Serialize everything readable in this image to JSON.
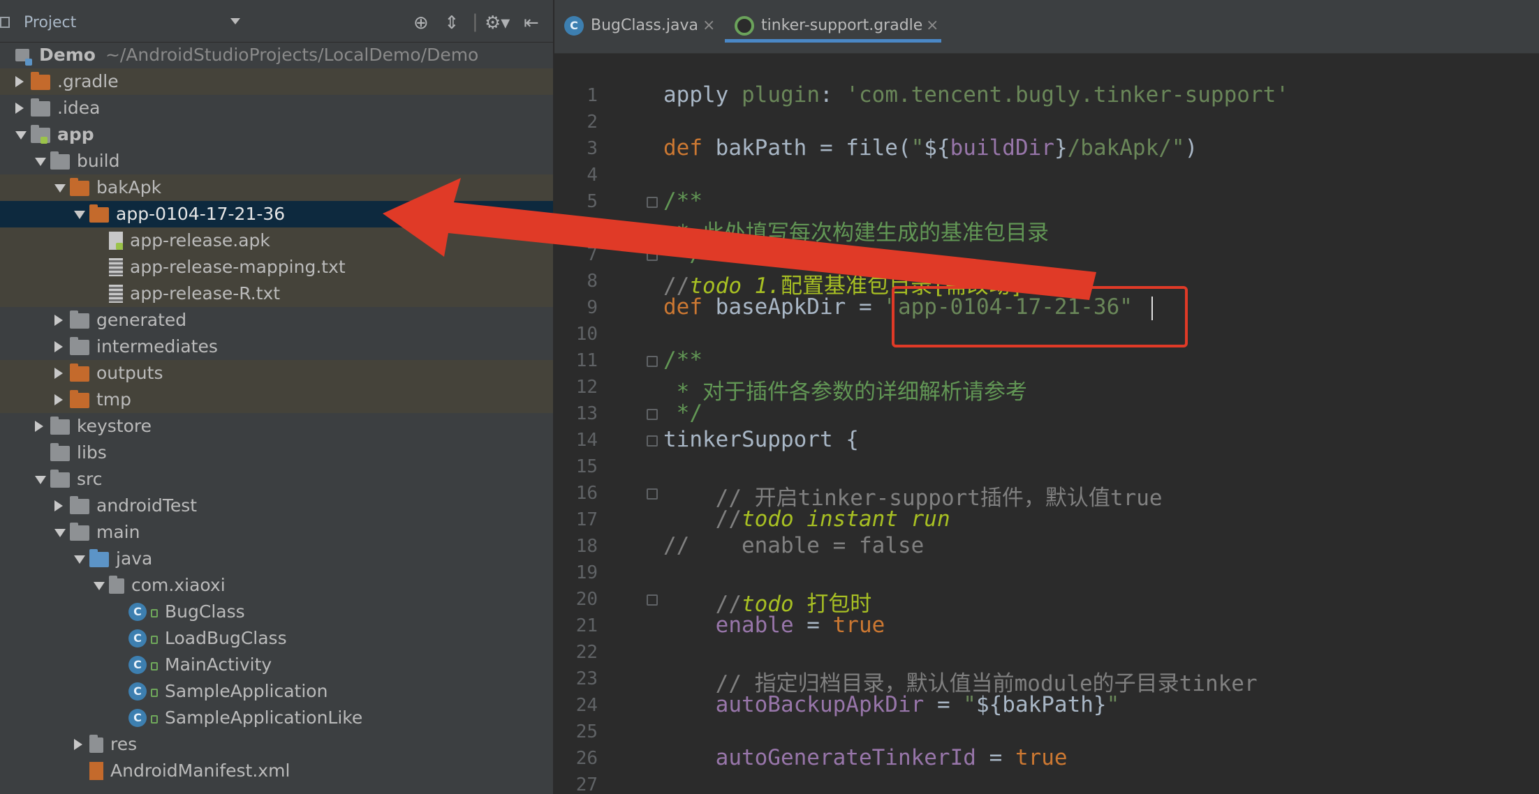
{
  "panel": {
    "title": "Project",
    "root_name": "Demo",
    "root_path": "~/AndroidStudioProjects/LocalDemo/Demo"
  },
  "tree": [
    {
      "label": ".gradle",
      "depth": 1,
      "arrow": "right",
      "icon": "folder-orange-icon",
      "highlight": true
    },
    {
      "label": ".idea",
      "depth": 1,
      "arrow": "right",
      "icon": "folder-icon"
    },
    {
      "label": "app",
      "depth": 1,
      "arrow": "down",
      "icon": "module-folder-icon",
      "bold": true
    },
    {
      "label": "build",
      "depth": 2,
      "arrow": "down",
      "icon": "folder-icon"
    },
    {
      "label": "bakApk",
      "depth": 3,
      "arrow": "down",
      "icon": "folder-orange-icon",
      "highlight": true
    },
    {
      "label": "app-0104-17-21-36",
      "depth": 4,
      "arrow": "down",
      "icon": "folder-orange-icon",
      "selected": true
    },
    {
      "label": "app-release.apk",
      "depth": 5,
      "icon": "apk-file-icon",
      "highlight": true
    },
    {
      "label": "app-release-mapping.txt",
      "depth": 5,
      "icon": "text-file-icon",
      "highlight": true
    },
    {
      "label": "app-release-R.txt",
      "depth": 5,
      "icon": "text-file-icon",
      "highlight": true
    },
    {
      "label": "generated",
      "depth": 3,
      "arrow": "right",
      "icon": "folder-icon"
    },
    {
      "label": "intermediates",
      "depth": 3,
      "arrow": "right",
      "icon": "folder-icon"
    },
    {
      "label": "outputs",
      "depth": 3,
      "arrow": "right",
      "icon": "folder-orange-icon",
      "highlight": true
    },
    {
      "label": "tmp",
      "depth": 3,
      "arrow": "right",
      "icon": "folder-orange-icon",
      "highlight": true
    },
    {
      "label": "keystore",
      "depth": 2,
      "arrow": "right",
      "icon": "folder-icon"
    },
    {
      "label": "libs",
      "depth": 2,
      "icon": "folder-icon"
    },
    {
      "label": "src",
      "depth": 2,
      "arrow": "down",
      "icon": "folder-icon"
    },
    {
      "label": "androidTest",
      "depth": 3,
      "arrow": "right",
      "icon": "folder-icon"
    },
    {
      "label": "main",
      "depth": 3,
      "arrow": "down",
      "icon": "folder-icon"
    },
    {
      "label": "java",
      "depth": 4,
      "arrow": "down",
      "icon": "folder-blue-icon"
    },
    {
      "label": "com.xiaoxi",
      "depth": 5,
      "arrow": "down",
      "icon": "package-icon"
    },
    {
      "label": "BugClass",
      "depth": 6,
      "icon": "class-icon"
    },
    {
      "label": "LoadBugClass",
      "depth": 6,
      "icon": "class-icon"
    },
    {
      "label": "MainActivity",
      "depth": 6,
      "icon": "class-icon"
    },
    {
      "label": "SampleApplication",
      "depth": 6,
      "icon": "class-icon"
    },
    {
      "label": "SampleApplicationLike",
      "depth": 6,
      "icon": "class-icon"
    },
    {
      "label": "res",
      "depth": 4,
      "arrow": "right",
      "icon": "res-folder-icon"
    },
    {
      "label": "AndroidManifest.xml",
      "depth": 4,
      "icon": "manifest-icon"
    }
  ],
  "tabs": [
    {
      "label": "BugClass.java",
      "icon": "java-class-icon",
      "close": "×"
    },
    {
      "label": "tinker-support.gradle",
      "icon": "gradle-icon",
      "close": "×",
      "active": true
    }
  ],
  "code_lines": [
    {
      "n": "1",
      "html": "<span class='fn'>apply</span> <span class='str' style='color:#6a8759'>plugin</span><span class='fn'>:</span> <span class='str'>'com.tencent.bugly.tinker-support'</span>"
    },
    {
      "n": "2",
      "html": ""
    },
    {
      "n": "3",
      "html": "<span class='kw'>def</span> bakPath = file(<span class='str'>\"</span>${<span class='prop'>buildDir</span>}<span class='str'>/bakApk/\"</span>)"
    },
    {
      "n": "4",
      "html": ""
    },
    {
      "n": "5",
      "html": "<span class='doc'>/**</span>",
      "fold": true
    },
    {
      "n": "6",
      "html": "<span class='doc'> * 此处填写每次构建生成的基准包目录</span>"
    },
    {
      "n": "7",
      "html": "<span class='doc'> */</span>",
      "fold": true
    },
    {
      "n": "8",
      "html": "<span class='cm'>//</span><span class='todo'>todo 1.</span><span class='todo-n'>配置基准包目录[需改动]</span>"
    },
    {
      "n": "9",
      "html": "<span class='kw'>def</span> baseApkDir = <span class='str'>\"app-0104-17-21-36\"</span>"
    },
    {
      "n": "10",
      "html": ""
    },
    {
      "n": "11",
      "html": "<span class='doc'>/**</span>",
      "fold": true
    },
    {
      "n": "12",
      "html": "<span class='doc'> * 对于插件各参数的详细解析请参考</span>"
    },
    {
      "n": "13",
      "html": "<span class='doc'> */</span>",
      "fold": true
    },
    {
      "n": "14",
      "html": "tinkerSupport {",
      "fold": true
    },
    {
      "n": "15",
      "html": ""
    },
    {
      "n": "16",
      "html": "    <span class='cm'>// 开启tinker-support插件，默认值true</span>",
      "fold": true
    },
    {
      "n": "17",
      "html": "    <span class='cm'>//</span><span class='todo'>todo instant run</span>"
    },
    {
      "n": "18",
      "html": "<span class='cm'>//    enable = false</span>"
    },
    {
      "n": "19",
      "html": ""
    },
    {
      "n": "20",
      "html": "    <span class='cm'>//</span><span class='todo'>todo </span><span class='todo-n'>打包时</span>",
      "fold": true
    },
    {
      "n": "21",
      "html": "    <span class='prop'>enable</span> = <span class='kw'>true</span>"
    },
    {
      "n": "22",
      "html": ""
    },
    {
      "n": "23",
      "html": "    <span class='cm'>// 指定归档目录，默认值当前module的子目录tinker</span>"
    },
    {
      "n": "24",
      "html": "    <span class='prop'>autoBackupApkDir</span> = <span class='str'>\"</span>${bakPath}<span class='str'>\"</span>"
    },
    {
      "n": "25",
      "html": ""
    },
    {
      "n": "26",
      "html": "    <span class='prop'>autoGenerateTinkerId</span> = <span class='kw'>true</span>"
    },
    {
      "n": "27",
      "html": ""
    }
  ],
  "colors": {
    "annotation_arrow": "#e03a27",
    "selection": "#0d293e",
    "highlight_row": "#45433a"
  }
}
